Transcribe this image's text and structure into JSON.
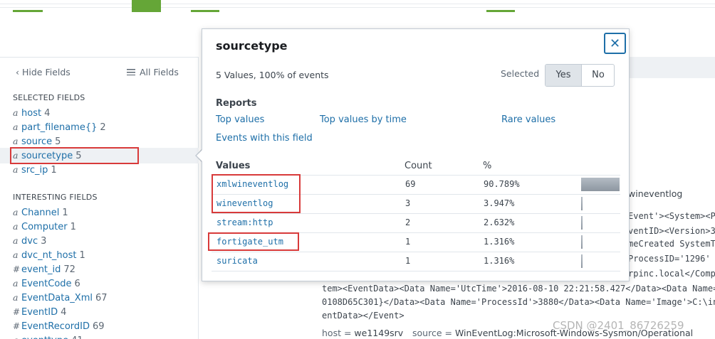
{
  "sidebar": {
    "hide_fields": "Hide Fields",
    "all_fields": "All Fields",
    "selected_title": "SELECTED FIELDS",
    "selected_fields": [
      {
        "type": "a",
        "name": "host",
        "count": "4"
      },
      {
        "type": "a",
        "name": "part_filename{}",
        "count": "2"
      },
      {
        "type": "a",
        "name": "source",
        "count": "5"
      },
      {
        "type": "a",
        "name": "sourcetype",
        "count": "5"
      },
      {
        "type": "a",
        "name": "src_ip",
        "count": "1"
      }
    ],
    "interesting_title": "INTERESTING FIELDS",
    "interesting_fields": [
      {
        "type": "a",
        "name": "Channel",
        "count": "1"
      },
      {
        "type": "a",
        "name": "Computer",
        "count": "1"
      },
      {
        "type": "a",
        "name": "dvc",
        "count": "3"
      },
      {
        "type": "a",
        "name": "dvc_nt_host",
        "count": "1"
      },
      {
        "type": "#",
        "name": "event_id",
        "count": "72"
      },
      {
        "type": "a",
        "name": "EventCode",
        "count": "6"
      },
      {
        "type": "a",
        "name": "EventData_Xml",
        "count": "67"
      },
      {
        "type": "#",
        "name": "EventID",
        "count": "4"
      },
      {
        "type": "#",
        "name": "EventRecordID",
        "count": "69"
      },
      {
        "type": "a",
        "name": "eventtype",
        "count": "41"
      }
    ]
  },
  "popup": {
    "title": "sourcetype",
    "close_glyph": "✕",
    "summary": "5 Values, 100% of events",
    "selected_label": "Selected",
    "yes": "Yes",
    "no": "No",
    "reports_title": "Reports",
    "reports": [
      "Top values",
      "Top values by time",
      "Rare values",
      "Events with this field"
    ],
    "col_values": "Values",
    "col_count": "Count",
    "col_pct": "%",
    "rows": [
      {
        "value": "xmlwineventlog",
        "count": "69",
        "pct": "90.789%",
        "fraction": 0.90789
      },
      {
        "value": "wineventlog",
        "count": "3",
        "pct": "3.947%",
        "fraction": 0.03947
      },
      {
        "value": "stream:http",
        "count": "2",
        "pct": "2.632%",
        "fraction": 0.02632
      },
      {
        "value": "fortigate_utm",
        "count": "1",
        "pct": "1.316%",
        "fraction": 0.01316
      },
      {
        "value": "suricata",
        "count": "1",
        "pct": "1.316%",
        "fraction": 0.01316
      }
    ]
  },
  "background": {
    "right_lines": [
      "wineventlog",
      "Event'><System><P",
      "ventID><Version>3",
      "meCreated SystemT",
      "ProcessID='1296'",
      "rpinc.local</Compu"
    ],
    "event_lines": [
      "tem><EventData><Data Name='UtcTime'>2016-08-10 22:21:58.427</Data><Data Name='P",
      "0108D65C301}</Data><Data Name='ProcessId'>3880</Data><Data Name='Image'>C:\\inet",
      "entData></Event>"
    ],
    "meta": {
      "host_key": "host =",
      "host_val": "we1149srv",
      "source_key": "source =",
      "source_val": "WinEventLog:Microsoft-Windows-Sysmon/Operational"
    },
    "watermark": "CSDN @2401_86726259"
  }
}
